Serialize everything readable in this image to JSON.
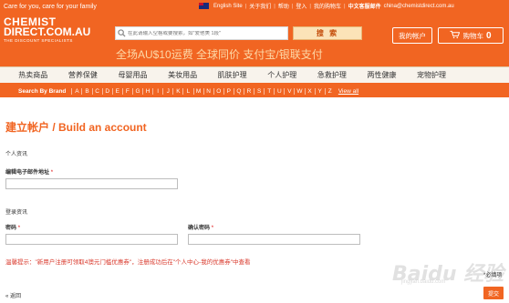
{
  "header": {
    "tagline": "Care for you, care for your family",
    "top_links": [
      "English Site",
      "关于我们",
      "帮助",
      "登入",
      "我的购物车"
    ],
    "contact_label": "中文客服邮件",
    "contact_email": "china@chemistdirect.com.au",
    "logo": {
      "line1": "CHEMIST",
      "line2": "DIRECT.COM.AU",
      "line3": "THE DISCOUNT SPECIALISTS"
    },
    "search": {
      "placeholder": "在此请输入空格或要搜索，如\"爱他美 1段\"",
      "button_label": "搜 索"
    },
    "promo": "全场AU$10运费 全球同价 支付宝/银联支付",
    "account_label": "我的帐户",
    "cart_label": "购物车",
    "cart_count": "0"
  },
  "categories": [
    "热卖商品",
    "营养保健",
    "母婴用品",
    "美妆用品",
    "肌肤护理",
    "个人护理",
    "急救护理",
    "两性健康",
    "宠物护理"
  ],
  "brand_bar": {
    "label": "Search By Brand",
    "letters": [
      "A",
      "B",
      "C",
      "D",
      "E",
      "F",
      "G",
      "H",
      "I",
      "J",
      "K",
      "L",
      "M",
      "N",
      "O",
      "P",
      "Q",
      "R",
      "S",
      "T",
      "U",
      "V",
      "W",
      "X",
      "Y",
      "Z"
    ],
    "view_all": "View all"
  },
  "form": {
    "title": "建立帐户 / Build an account",
    "personal_section": "个人资讯",
    "email_label": "编辑电子邮件地址",
    "login_section": "登录资讯",
    "password_label": "密码",
    "confirm_label": "确认密码",
    "required_mark": "*",
    "tip": "温馨提示：\"新用户注册可领取4澳元门槛优惠券\"，注册成功后在\"个人中心-我的优惠券\"中查看",
    "required_note": "*必填项",
    "back_label": "« 返回",
    "submit_label": "提交"
  },
  "watermark": {
    "text": "Baidu 经验",
    "sub": "jingyan.baidu.com"
  },
  "colors": {
    "brand_orange": "#f16522",
    "tip_red": "#d9382b"
  }
}
